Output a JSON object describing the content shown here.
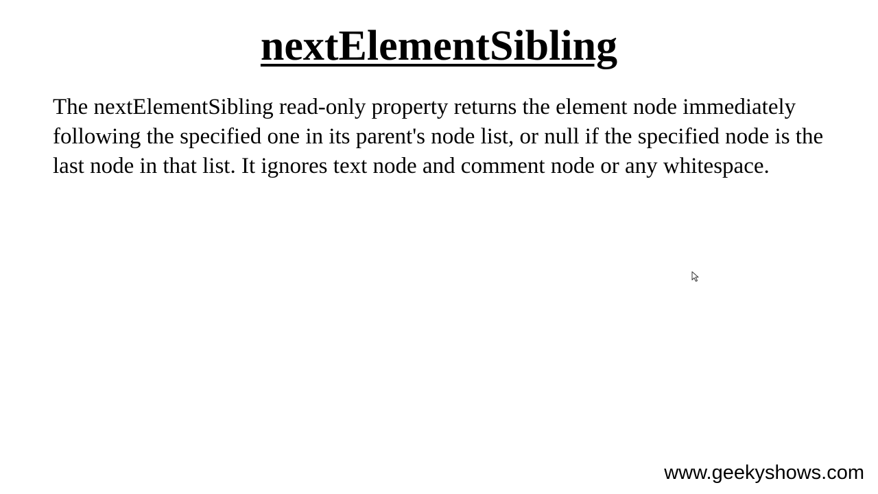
{
  "slide": {
    "title": "nextElementSibling",
    "description": "The nextElementSibling read-only property returns the element node immediately following the specified one in its parent's node list, or null if the specified node is the last node in that list. It ignores text node and comment node or any whitespace.",
    "watermark": "www.geekyshows.com"
  },
  "cursor": {
    "icon": "mouse-pointer-icon"
  },
  "colors": {
    "background": "#ffffff",
    "text": "#000000"
  }
}
